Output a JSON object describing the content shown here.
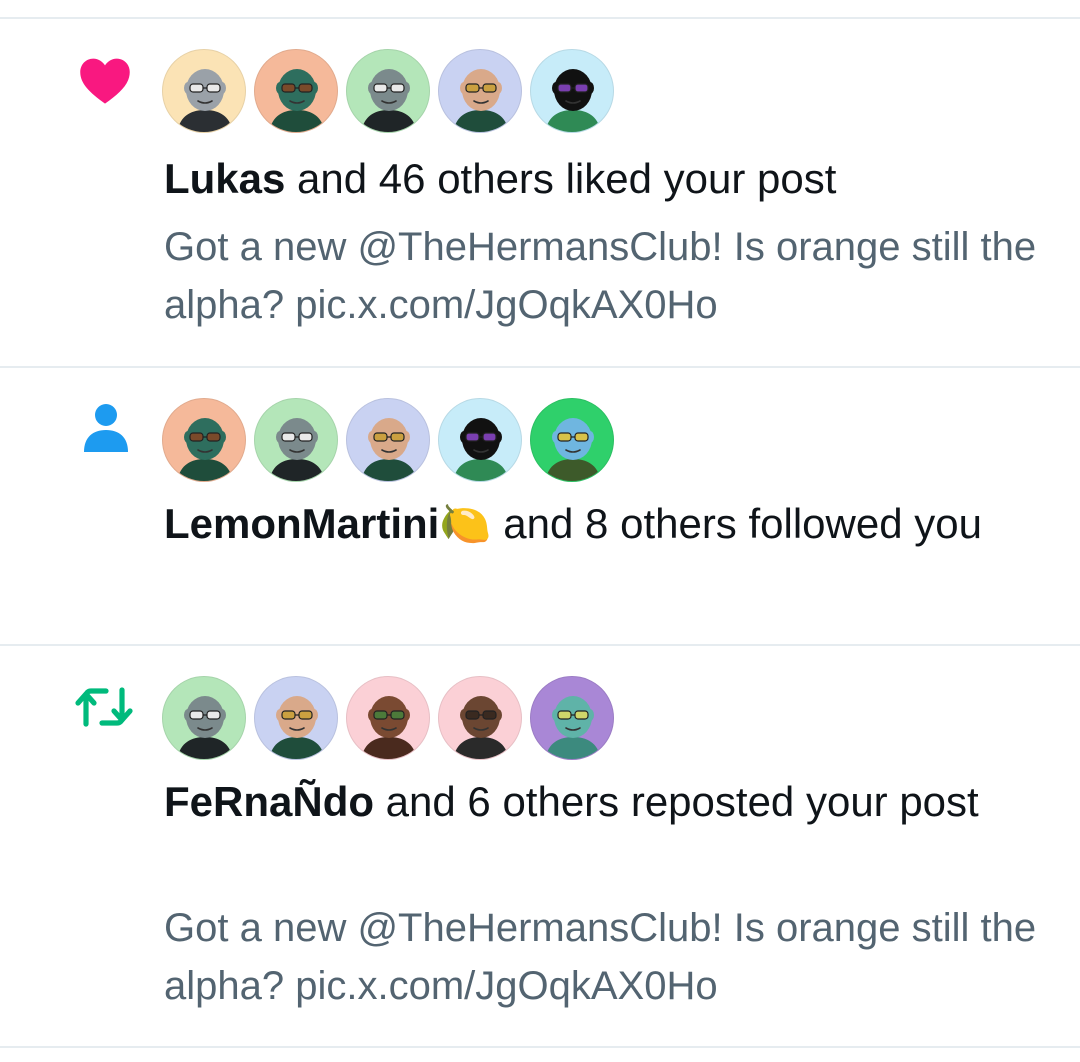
{
  "notifications": [
    {
      "type": "like",
      "icon": "heart-icon",
      "icon_color": "#f91880",
      "avatars": [
        {
          "bg": "#fbe3b5",
          "skin": "#9aa1a8",
          "shirt": "#2b2f33",
          "glasses": "#e9e9e9"
        },
        {
          "bg": "#f5b99a",
          "skin": "#2e6e5e",
          "shirt": "#1f4d3b",
          "glasses": "#7a4a2a"
        },
        {
          "bg": "#b4e6b9",
          "skin": "#7b8a8c",
          "shirt": "#1f2527",
          "glasses": "#e9e9e9"
        },
        {
          "bg": "#c9d2f2",
          "skin": "#d9a98a",
          "shirt": "#1f4d3b",
          "glasses": "#caa040"
        },
        {
          "bg": "#c7ecf9",
          "skin": "#111111",
          "shirt": "#2f8a55",
          "glasses": "#7a3fb0"
        }
      ],
      "actor": "Lukas",
      "action": " and 46 others liked your post",
      "preview": "Got a new @TheHermansClub! Is orange still the alpha? pic.x.com/JgOqkAX0Ho"
    },
    {
      "type": "follow",
      "icon": "person-icon",
      "icon_color": "#1d9bf0",
      "avatars": [
        {
          "bg": "#f5b99a",
          "skin": "#2e6e5e",
          "shirt": "#1f4d3b",
          "glasses": "#7a4a2a"
        },
        {
          "bg": "#b4e6b9",
          "skin": "#7b8a8c",
          "shirt": "#1f2527",
          "glasses": "#e9e9e9"
        },
        {
          "bg": "#c9d2f2",
          "skin": "#d9a98a",
          "shirt": "#1f4d3b",
          "glasses": "#caa040"
        },
        {
          "bg": "#c7ecf9",
          "skin": "#111111",
          "shirt": "#2f8a55",
          "glasses": "#7a3fb0"
        },
        {
          "bg": "#2fd06b",
          "skin": "#6fb6e0",
          "shirt": "#3d5a2a",
          "glasses": "#d7c24a"
        }
      ],
      "actor": "LemonMartini🍋",
      "action": " and 8 others followed you",
      "preview": ""
    },
    {
      "type": "repost",
      "icon": "repost-icon",
      "icon_color": "#00ba7c",
      "avatars": [
        {
          "bg": "#b4e6b9",
          "skin": "#7b8a8c",
          "shirt": "#1f2527",
          "glasses": "#e9e9e9"
        },
        {
          "bg": "#c9d2f2",
          "skin": "#d9a98a",
          "shirt": "#1f4d3b",
          "glasses": "#caa040"
        },
        {
          "bg": "#fbd0d6",
          "skin": "#7a4a32",
          "shirt": "#4a2a1e",
          "glasses": "#4c7a3a"
        },
        {
          "bg": "#fbd0d6",
          "skin": "#6b4632",
          "shirt": "#2a2a2a",
          "glasses": "#3a2a20"
        },
        {
          "bg": "#a987d6",
          "skin": "#5fb3a8",
          "shirt": "#3c8a7e",
          "glasses": "#cfd66a"
        }
      ],
      "actor": "FeRnaÑdo",
      "action": " and 6 others reposted your post",
      "preview": "Got a new @TheHermansClub! Is orange still the alpha? pic.x.com/JgOqkAX0Ho"
    }
  ]
}
